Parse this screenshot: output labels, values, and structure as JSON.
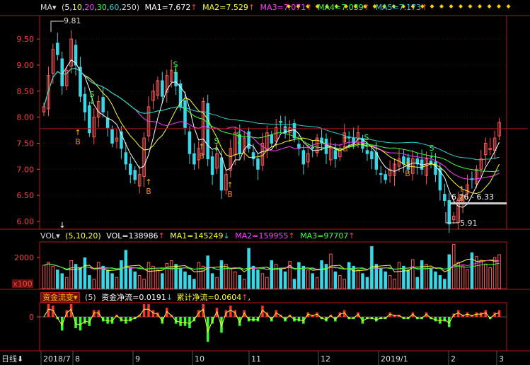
{
  "colors": {
    "up": "#ff5a5a",
    "down": "#39d7e8",
    "frame": "#b01818",
    "ma1": "#ffffff",
    "ma2": "#ffff30",
    "ma3": "#ff40ff",
    "ma4": "#40ff40",
    "ma5": "#30d0d0"
  },
  "ma_header": {
    "label": "MA",
    "params_open": "(",
    "params": [
      "5",
      "10",
      "20",
      "30",
      "60",
      "250"
    ],
    "params_close": ")",
    "items": [
      {
        "text": "MA1=7.672",
        "arrow": "↑"
      },
      {
        "text": "MA2=7.529",
        "arrow": "↑"
      },
      {
        "text": "MA3=7.071",
        "arrow": "↑"
      },
      {
        "text": "MA4=7.039",
        "arrow": "↑"
      },
      {
        "text": "MA5=7.173",
        "arrow": "↑"
      }
    ]
  },
  "price_axis": [
    "9.50",
    "9.00",
    "8.50",
    "8.00",
    "7.50",
    "7.00",
    "6.50",
    "6.00"
  ],
  "price_annotations": {
    "high": "9.81",
    "low": "5.91",
    "range": "6.26 - 6.33"
  },
  "signals": {
    "buy": "B",
    "sell": "S"
  },
  "vol_header": {
    "label": "VOL",
    "params": "(5,10,20)",
    "items": [
      {
        "text": "VOL=138986",
        "arrow": "↑"
      },
      {
        "text": "MA1=145249",
        "arrow": "↓"
      },
      {
        "text": "MA2=159955",
        "arrow": "↑"
      },
      {
        "text": "MA3=97707",
        "arrow": "↑"
      }
    ]
  },
  "vol_axis": {
    "tick": "2000",
    "unit": "x100"
  },
  "fund_header": {
    "name": "资金流变",
    "param": "(5)",
    "items": [
      {
        "text": "资金净流=0.0191",
        "arrow": "↓"
      },
      {
        "text": "累计净流=0.0604",
        "arrow": "↑"
      }
    ],
    "tail": ","
  },
  "fund_axis": {
    "tick": "0"
  },
  "period_button": "日线",
  "dates": [
    "2018/7",
    "8",
    "9",
    "10",
    "11",
    "12",
    "2019/1",
    "2",
    "3"
  ],
  "chart_data": {
    "type": "candlestick",
    "ylim": [
      5.85,
      9.95
    ],
    "x": [
      "2018/7",
      "8",
      "9",
      "10",
      "11",
      "12",
      "2019/1",
      "2",
      "3"
    ],
    "closes": [
      8.2,
      8.8,
      9.3,
      9.2,
      8.6,
      8.9,
      9.5,
      9.0,
      8.4,
      8.1,
      7.7,
      8.0,
      8.3,
      8.1,
      7.8,
      7.5,
      7.6,
      7.4,
      7.1,
      6.9,
      6.8,
      6.9,
      7.6,
      8.2,
      8.5,
      8.7,
      8.4,
      8.8,
      8.9,
      8.6,
      8.2,
      7.8,
      7.3,
      7.1,
      7.4,
      8.3,
      7.2,
      6.9,
      7.3,
      6.6,
      6.9,
      7.4,
      7.7,
      7.3,
      7.6,
      7.4,
      7.2,
      7.0,
      7.5,
      7.7,
      7.5,
      7.8,
      7.9,
      7.7,
      7.8,
      7.6,
      7.4,
      7.1,
      7.3,
      7.4,
      7.6,
      7.5,
      7.3,
      7.4,
      7.2,
      7.4,
      7.7,
      7.6,
      7.5,
      7.7,
      7.4,
      7.3,
      7.2,
      7.0,
      6.9,
      6.8,
      7.0,
      7.1,
      7.2,
      7.1,
      7.0,
      7.2,
      7.1,
      7.0,
      7.2,
      7.1,
      6.9,
      6.6,
      6.4,
      5.95,
      6.1,
      6.4,
      6.5,
      6.7,
      6.8,
      7.0,
      7.2,
      7.5,
      7.4,
      7.6,
      7.9
    ],
    "volume_scale": [
      0,
      3000
    ],
    "vol_axis_tick": 2000,
    "fund_flow_scale": [
      -0.12,
      0.05
    ]
  }
}
